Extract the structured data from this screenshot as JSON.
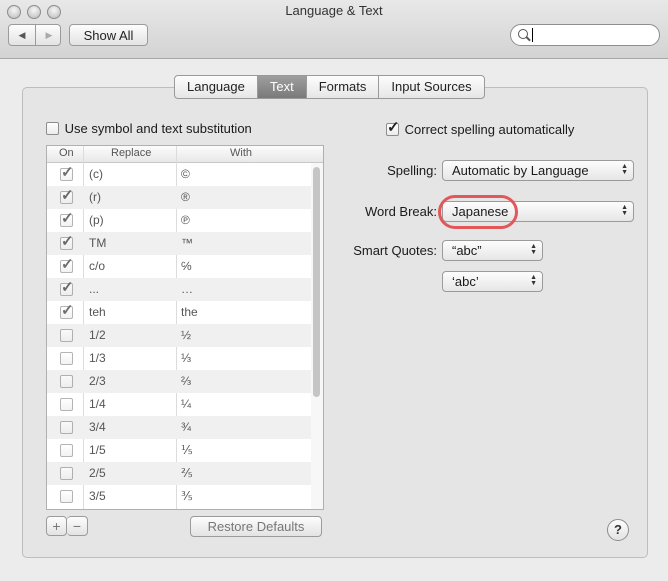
{
  "window": {
    "title": "Language & Text"
  },
  "toolbar": {
    "show_all_label": "Show All",
    "search_value": ""
  },
  "tabs": [
    {
      "label": "Language",
      "active": false
    },
    {
      "label": "Text",
      "active": true
    },
    {
      "label": "Formats",
      "active": false
    },
    {
      "label": "Input Sources",
      "active": false
    }
  ],
  "substitution": {
    "checkbox_label": "Use symbol and text substitution",
    "checked": false,
    "columns": {
      "on": "On",
      "replace": "Replace",
      "with": "With"
    },
    "rows": [
      {
        "on": true,
        "replace": "(c)",
        "with": "©"
      },
      {
        "on": true,
        "replace": "(r)",
        "with": "®"
      },
      {
        "on": true,
        "replace": "(p)",
        "with": "℗"
      },
      {
        "on": true,
        "replace": "TM",
        "with": "™"
      },
      {
        "on": true,
        "replace": "c/o",
        "with": "℅"
      },
      {
        "on": true,
        "replace": "...",
        "with": "…"
      },
      {
        "on": true,
        "replace": "teh",
        "with": "the"
      },
      {
        "on": false,
        "replace": "1/2",
        "with": "½"
      },
      {
        "on": false,
        "replace": "1/3",
        "with": "⅓"
      },
      {
        "on": false,
        "replace": "2/3",
        "with": "⅔"
      },
      {
        "on": false,
        "replace": "1/4",
        "with": "¼"
      },
      {
        "on": false,
        "replace": "3/4",
        "with": "¾"
      },
      {
        "on": false,
        "replace": "1/5",
        "with": "⅕"
      },
      {
        "on": false,
        "replace": "2/5",
        "with": "⅖"
      },
      {
        "on": false,
        "replace": "3/5",
        "with": "⅗"
      }
    ],
    "add_label": "+",
    "remove_label": "−",
    "restore_label": "Restore Defaults"
  },
  "spelling": {
    "correct_label": "Correct spelling automatically",
    "correct_checked": true,
    "spelling_label": "Spelling:",
    "spelling_value": "Automatic by Language",
    "word_break_label": "Word Break:",
    "word_break_value": "Japanese",
    "smart_quotes_label": "Smart Quotes:",
    "double_quotes_value": "“abc”",
    "single_quotes_value": "‘abc’"
  },
  "help_label": "?",
  "colors": {
    "highlight_ring": "#e0585a",
    "active_tab": "#8a8a8a"
  }
}
